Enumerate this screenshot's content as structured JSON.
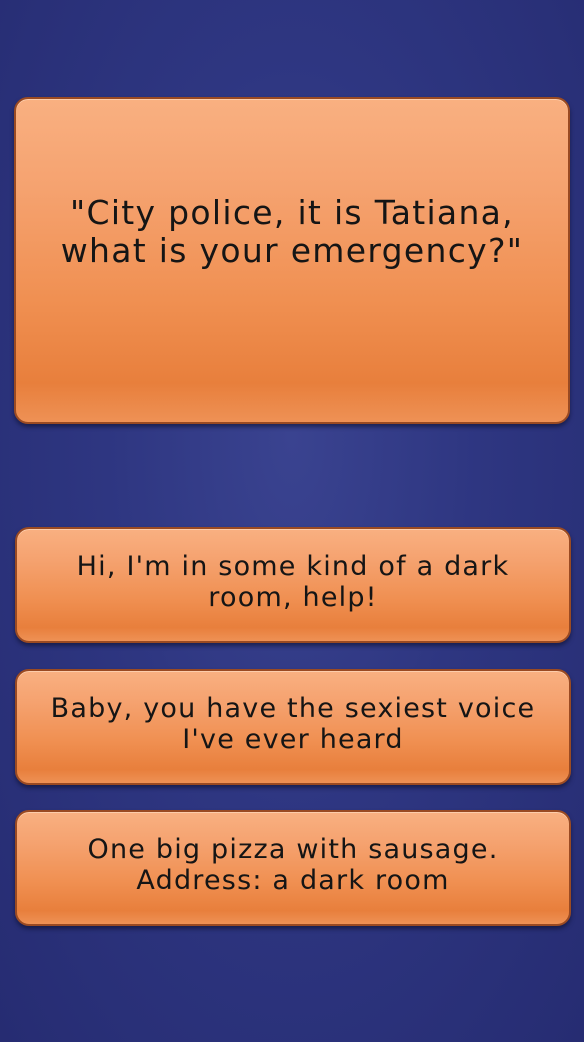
{
  "dialogue": {
    "prompt": "\"City police, it is Tatiana, what is your emergency?\""
  },
  "options": [
    {
      "label": "Hi, I'm in some kind of a dark room, help!"
    },
    {
      "label": "Baby, you have the sexiest voice I've ever heard"
    },
    {
      "label": "One big pizza with sausage. Address: a dark room"
    }
  ],
  "colors": {
    "background": "#2e3681",
    "card_orange": "#f09052",
    "card_border": "#9a4a22",
    "text": "#151515"
  }
}
